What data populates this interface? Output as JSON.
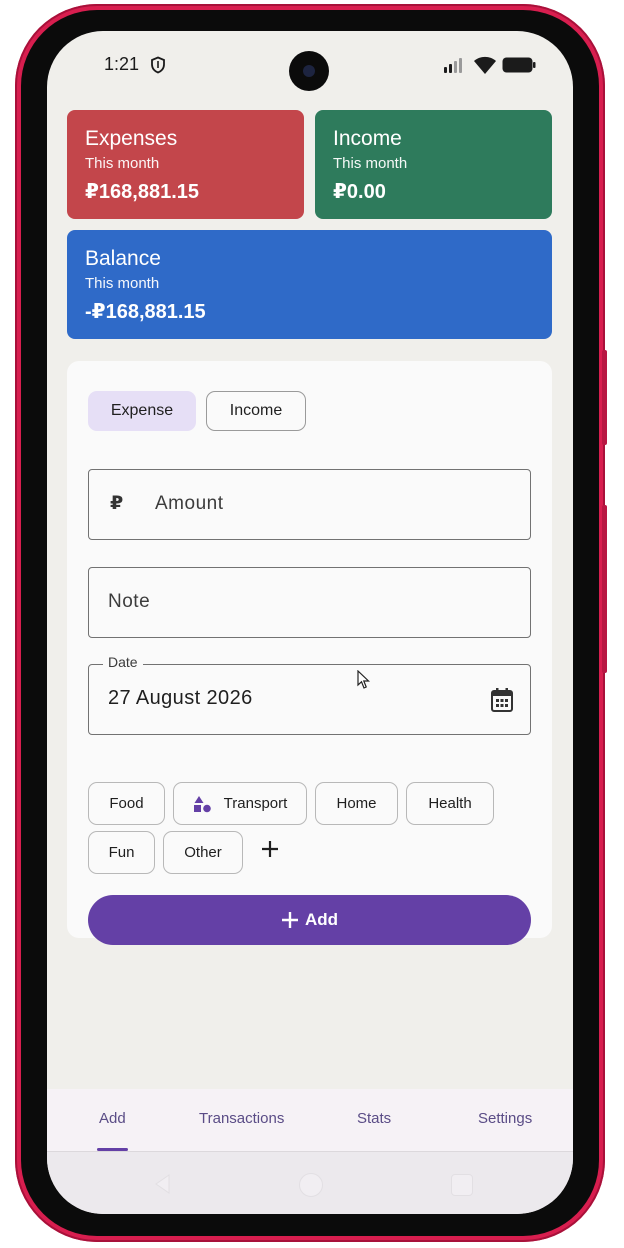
{
  "status_bar": {
    "time": "1:21"
  },
  "summary": {
    "expenses": {
      "title": "Expenses",
      "period": "This month",
      "value": "₽168,881.15",
      "color": "#c3464b"
    },
    "income": {
      "title": "Income",
      "period": "This month",
      "value": "₽0.00",
      "color": "#2e7b5c"
    },
    "balance": {
      "title": "Balance",
      "period": "This month",
      "value": "-₽168,881.15",
      "color": "#2f6ac8"
    }
  },
  "form": {
    "type_toggle": {
      "options": [
        "Expense",
        "Income"
      ],
      "selected": "Expense"
    },
    "amount": {
      "prefix": "₽",
      "placeholder": "Amount",
      "value": ""
    },
    "note": {
      "placeholder": "Note",
      "value": ""
    },
    "date": {
      "label": "Date",
      "value": "27 August 2026",
      "icon": "calendar-icon"
    },
    "categories": [
      {
        "label": "Food"
      },
      {
        "label": "Transport",
        "icon": "shapes-icon"
      },
      {
        "label": "Home"
      },
      {
        "label": "Health"
      },
      {
        "label": "Fun"
      },
      {
        "label": "Other"
      }
    ],
    "add_category_icon": "plus-icon",
    "submit_label": "Add",
    "accent_color": "#6440a6"
  },
  "bottom_nav": {
    "items": [
      "Add",
      "Transactions",
      "Stats",
      "Settings"
    ],
    "selected": "Add"
  }
}
